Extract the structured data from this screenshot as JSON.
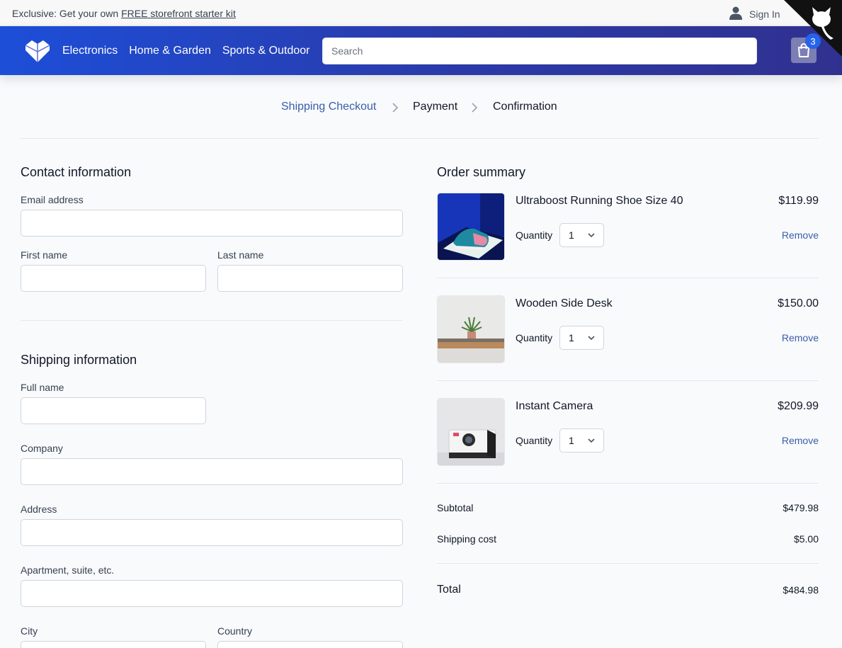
{
  "promo": {
    "prefix": "Exclusive: Get your own ",
    "link": "FREE storefront starter kit"
  },
  "account": {
    "sign_in": "Sign In"
  },
  "header": {
    "nav": [
      "Electronics",
      "Home & Garden",
      "Sports & Outdoor"
    ],
    "search_placeholder": "Search",
    "cart_count": "3"
  },
  "steps": [
    "Shipping Checkout",
    "Payment",
    "Confirmation"
  ],
  "contact": {
    "title": "Contact information",
    "email_label": "Email address",
    "first_name_label": "First name",
    "last_name_label": "Last name"
  },
  "shipping": {
    "title": "Shipping information",
    "full_name_label": "Full name",
    "company_label": "Company",
    "address_label": "Address",
    "apartment_label": "Apartment, suite, etc.",
    "city_label": "City",
    "country_label": "Country"
  },
  "summary": {
    "title": "Order summary",
    "quantity_label": "Quantity",
    "remove_label": "Remove",
    "items": [
      {
        "name": "Ultraboost Running Shoe Size 40",
        "price": "$119.99",
        "quantity": "1"
      },
      {
        "name": "Wooden Side Desk",
        "price": "$150.00",
        "quantity": "1"
      },
      {
        "name": "Instant Camera",
        "price": "$209.99",
        "quantity": "1"
      }
    ],
    "subtotal_label": "Subtotal",
    "subtotal": "$479.98",
    "shipping_label": "Shipping cost",
    "shipping": "$5.00",
    "total_label": "Total",
    "total": "$484.98"
  },
  "colors": {
    "header_start": "#1d4ed8",
    "header_end": "#30318f",
    "link": "#3b5ea8",
    "badge": "#2563eb"
  }
}
